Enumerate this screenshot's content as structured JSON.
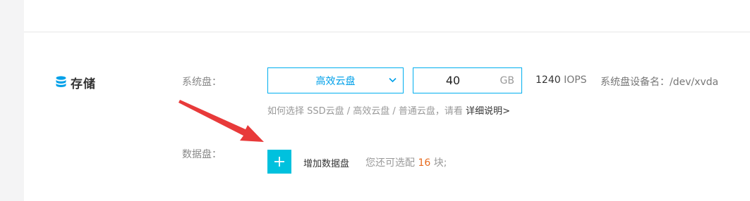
{
  "storage": {
    "title": "存储",
    "icon": "database-icon",
    "system_disk": {
      "label": "系统盘：",
      "type_value": "高效云盘",
      "size_value": "40",
      "size_unit": "GB",
      "iops_value": "1240",
      "iops_unit": "IOPS",
      "device_name": "系统盘设备名：/dev/xvda",
      "hint_text": "如何选择 SSD云盘 / 高效云盘 / 普通云盘，请看 ",
      "hint_link": "详细说明>"
    },
    "data_disk": {
      "label": "数据盘：",
      "add_label": "增加数据盘",
      "remain_prefix": "您还可选配",
      "remain_count": "16",
      "remain_suffix": "块;"
    }
  },
  "colors": {
    "accent": "#00aeef",
    "add_button": "#00c1de",
    "highlight_count": "#e76b1f",
    "annotation_arrow": "#e83a3a"
  }
}
